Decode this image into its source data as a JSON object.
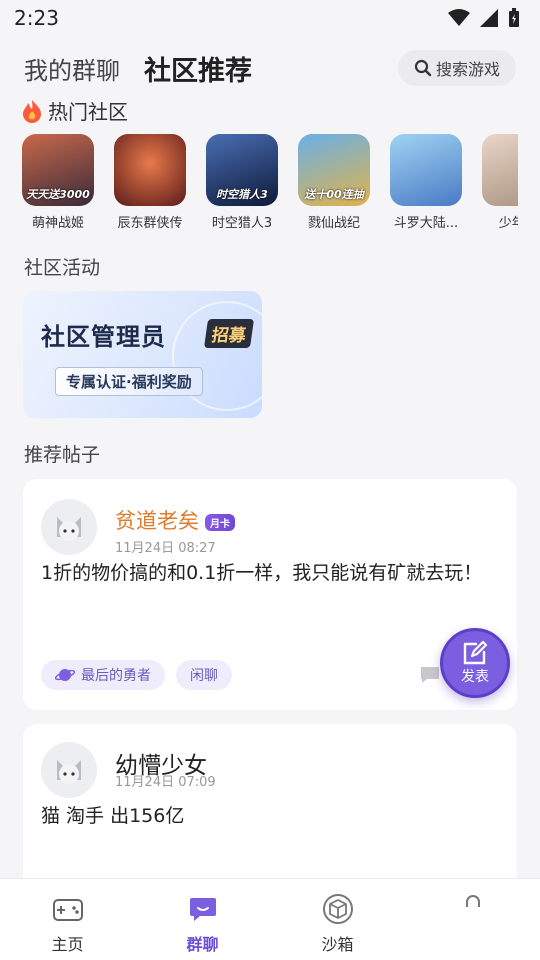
{
  "status": {
    "time": "2:23"
  },
  "header": {
    "tab_my_groups": "我的群聊",
    "tab_community": "社区推荐",
    "search_label": "搜索游戏"
  },
  "hot": {
    "title": "热门社区",
    "games": [
      {
        "name": "萌神战姬",
        "badge": "天天送3000",
        "color_a": "#c96a4a",
        "color_b": "#3a2a3a"
      },
      {
        "name": "辰东群侠传",
        "badge": "",
        "color_a": "#d2533a",
        "color_b": "#5a1a1a"
      },
      {
        "name": "时空猎人3",
        "badge": "时空猎人3",
        "color_a": "#4a6fb4",
        "color_b": "#0e1a3a"
      },
      {
        "name": "戮仙战纪",
        "badge": "送十00连抽",
        "color_a": "#6ab0e8",
        "color_b": "#e0b24a"
      },
      {
        "name": "斗罗大陆...",
        "badge": "",
        "color_a": "#9fd4f4",
        "color_b": "#4a7ac4"
      },
      {
        "name": "少年...",
        "badge": "",
        "color_a": "#e8d6c6",
        "color_b": "#a89080"
      }
    ]
  },
  "activities": {
    "title": "社区活动",
    "banner_title": "社区管理员",
    "banner_tag": "招募",
    "banner_sub": "专属认证·福利奖励"
  },
  "posts_section": {
    "title": "推荐帖子"
  },
  "posts": [
    {
      "author": "贫道老矣",
      "badge": "月卡",
      "time": "11月24日 08:27",
      "text": "1折的物价搞的和0.1折一样，我只能说有矿就去玩！",
      "tags": [
        "最后的勇者",
        "闲聊"
      ]
    },
    {
      "author": "幼懵少女",
      "time": "11月24日 07:09",
      "text": "猫 淘手 出156亿"
    }
  ],
  "fab": {
    "label": "发表"
  },
  "nav": {
    "home": "主页",
    "groups": "群聊",
    "sandbox": "沙箱"
  },
  "colors": {
    "accent": "#6b4fd8",
    "author_orange": "#e07b2a"
  }
}
